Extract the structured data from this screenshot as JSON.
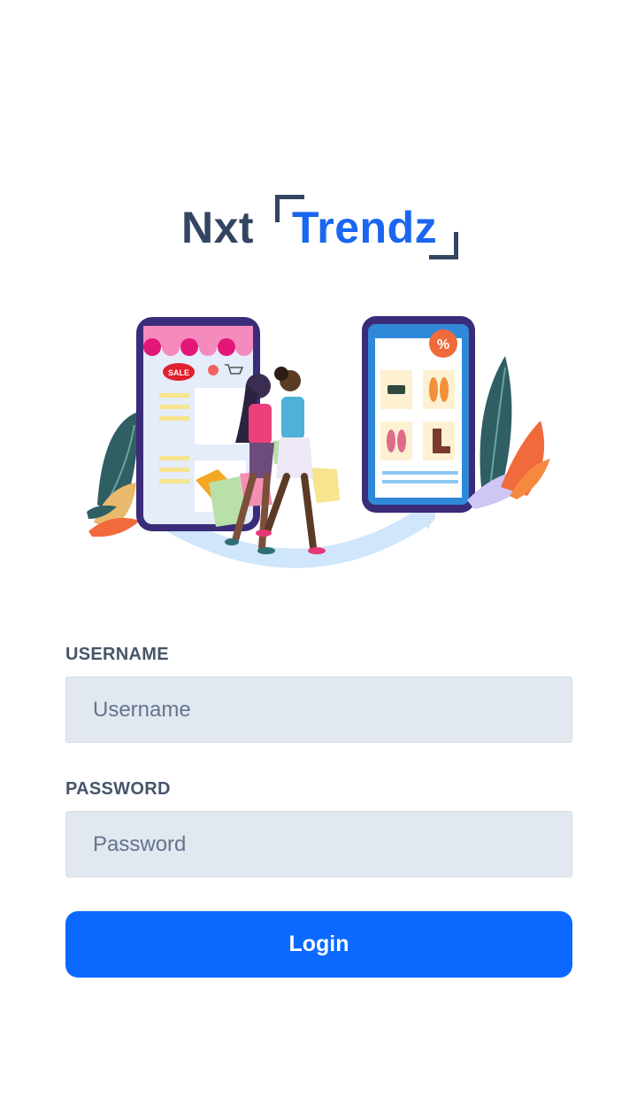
{
  "brand": {
    "part1": "Nxt",
    "part2": "Trendz"
  },
  "illustration": {
    "sale_badge": "SALE",
    "discount_badge": "%"
  },
  "form": {
    "username_label": "USERNAME",
    "username_placeholder": "Username",
    "password_label": "PASSWORD",
    "password_placeholder": "Password",
    "login_label": "Login"
  },
  "colors": {
    "brand_dark": "#334561",
    "brand_blue": "#1a66f0",
    "button": "#0b69ff",
    "input_bg": "#e2e8f0"
  }
}
